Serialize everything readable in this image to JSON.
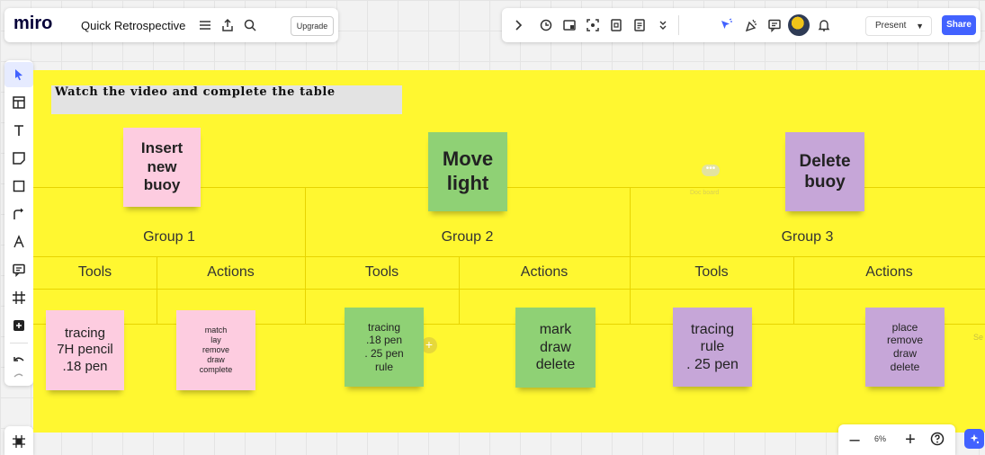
{
  "app": {
    "logo": "miro",
    "board_title": "Quick Retrospective",
    "upgrade_label": "Upgrade"
  },
  "topbar": {
    "present_label": "Present",
    "share_label": "Share",
    "icons": [
      "chevron-right-icon",
      "timer-icon",
      "card-icon",
      "focus-icon",
      "notes-icon",
      "document-icon",
      "more-icon",
      "cursor-reaction-icon",
      "celebrate-icon",
      "comment-icon",
      "avatar",
      "bell-icon"
    ]
  },
  "toolbar": {
    "tools": [
      "select-icon",
      "templates-icon",
      "text-icon",
      "sticky-note-icon",
      "shape-icon",
      "connector-icon",
      "pen-icon",
      "comment-icon",
      "frame-icon",
      "add-icon",
      "undo-icon",
      "redo-icon"
    ]
  },
  "board": {
    "frame_title": "Watch the video and complete the table",
    "groups": [
      "Group 1",
      "Group 2",
      "Group 3"
    ],
    "headers": [
      "Tools",
      "Actions",
      "Tools",
      "Actions",
      "Tools",
      "Actions"
    ],
    "edge_hint": "Se",
    "hidden_label": "Doc board"
  },
  "colors": {
    "board": "#fff730",
    "pink": "#fdcce0",
    "green": "#8fd175",
    "purple": "#c6a6d8",
    "accent": "#4262ff"
  },
  "stickies": {
    "insert": "Insert\nnew\nbuoy",
    "move": "Move\nlight",
    "delete": "Delete\nbuoy",
    "g1_tools": "tracing\n7H pencil\n.18 pen",
    "g1_actions": "match\nlay\nremove\ndraw\ncomplete",
    "g2_tools": "tracing\n.18 pen\n. 25 pen\nrule",
    "g2_actions": "mark\ndraw\ndelete",
    "g3_tools": "tracing\nrule\n. 25 pen",
    "g3_actions": "place\nremove\ndraw\ndelete"
  },
  "zoom": {
    "level": "6%"
  }
}
